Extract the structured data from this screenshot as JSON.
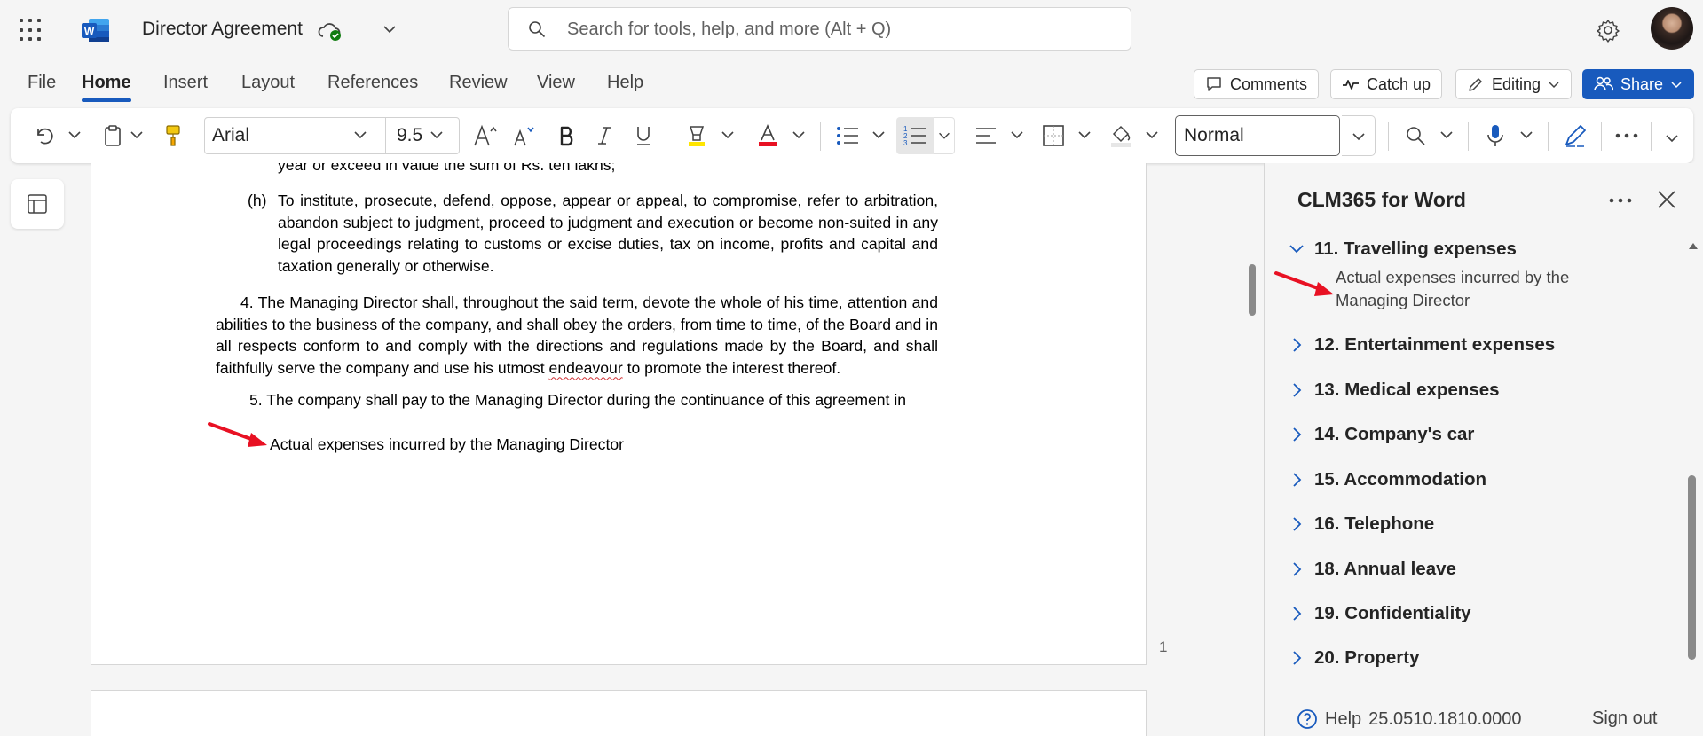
{
  "titlebar": {
    "document_title": "Director Agreement",
    "search_placeholder": "Search for tools, help, and more (Alt + Q)"
  },
  "menu": {
    "tabs": [
      "File",
      "Home",
      "Insert",
      "Layout",
      "References",
      "Review",
      "View",
      "Help"
    ],
    "active_tab": "Home",
    "comments_label": "Comments",
    "catch_up_label": "Catch up",
    "editing_label": "Editing",
    "share_label": "Share"
  },
  "ribbon": {
    "font_name": "Arial",
    "font_size": "9.5",
    "style_name": "Normal"
  },
  "document": {
    "clipped_line": "year or exceed in value the sum of Rs. ten lakhs;",
    "para_h_label": "(h)",
    "para_h_text": "To institute, prosecute, defend, oppose, appear or appeal, to compromise, refer to arbitration, abandon subject to judgment, proceed to judgment and execution or become non-suited in any legal proceedings relating to customs or excise duties, tax on income, profits and capital and taxation generally or otherwise.",
    "para4_before": "4. The Managing Director shall, throughout the said term, devote the whole of his time, attention and abilities to the business of the company, and shall obey the orders, from time to time, of the Board and in all respects conform to and comply with the directions and regulations made by the Board, and shall faithfully serve the company and use his utmost ",
    "para4_misspelled": "endeavour",
    "para4_after": " to promote the interest thereof.",
    "para5": "5.  The company shall pay to the Managing Director during the continuance of this agreement in",
    "actual_expenses": "Actual expenses incurred by the Managing Director",
    "page_number": "1"
  },
  "side_pane": {
    "title": "CLM365 for Word",
    "expanded_item": "11. Travelling expenses",
    "expanded_content": "Actual expenses incurred by the Managing Director",
    "items": [
      "12. Entertainment expenses",
      "13. Medical expenses",
      "14. Company's car",
      "15. Accommodation",
      "16. Telephone",
      "18. Annual leave",
      "19. Confidentiality",
      "20. Property"
    ],
    "help_label": "Help",
    "version": "25.0510.1810.0000",
    "sign_out_label": "Sign out"
  },
  "colors": {
    "accent": "#185abd",
    "arrow": "#e81123",
    "misspelling": "#d13438"
  }
}
